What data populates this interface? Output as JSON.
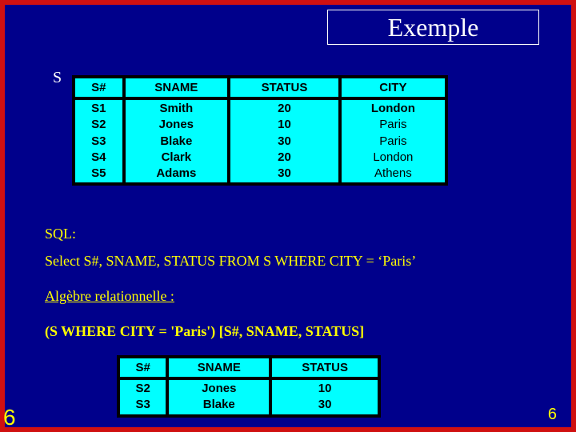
{
  "title": "Exemple",
  "s_label": "S",
  "table_s": {
    "headers": [
      "S#",
      "SNAME",
      "STATUS",
      "CITY"
    ],
    "rows": [
      [
        "S1",
        "Smith",
        "20",
        "London"
      ],
      [
        "S2",
        "Jones",
        "10",
        "Paris"
      ],
      [
        "S3",
        "Blake",
        "30",
        "Paris"
      ],
      [
        "S4",
        "Clark",
        "20",
        "London"
      ],
      [
        "S5",
        "Adams",
        "30",
        "Athens"
      ]
    ]
  },
  "lines": {
    "sql_label": "SQL:",
    "sql_stmt": "Select S#, SNAME, STATUS FROM S WHERE CITY = ‘Paris’",
    "alg_label": "Algèbre relationnelle :",
    "alg_expr": "(S WHERE CITY = 'Paris') [S#, SNAME, STATUS]"
  },
  "table_result": {
    "headers": [
      "S#",
      "SNAME",
      "STATUS"
    ],
    "rows": [
      [
        "S2",
        "Jones",
        "10"
      ],
      [
        "S3",
        "Blake",
        "30"
      ]
    ]
  },
  "page_number_left": "6",
  "page_number_right": "6",
  "chart_data": [
    {
      "type": "table",
      "title": "S",
      "columns": [
        "S#",
        "SNAME",
        "STATUS",
        "CITY"
      ],
      "rows": [
        [
          "S1",
          "Smith",
          20,
          "London"
        ],
        [
          "S2",
          "Jones",
          10,
          "Paris"
        ],
        [
          "S3",
          "Blake",
          30,
          "Paris"
        ],
        [
          "S4",
          "Clark",
          20,
          "London"
        ],
        [
          "S5",
          "Adams",
          30,
          "Athens"
        ]
      ]
    },
    {
      "type": "table",
      "title": "Result",
      "columns": [
        "S#",
        "SNAME",
        "STATUS"
      ],
      "rows": [
        [
          "S2",
          "Jones",
          10
        ],
        [
          "S3",
          "Blake",
          30
        ]
      ]
    }
  ]
}
